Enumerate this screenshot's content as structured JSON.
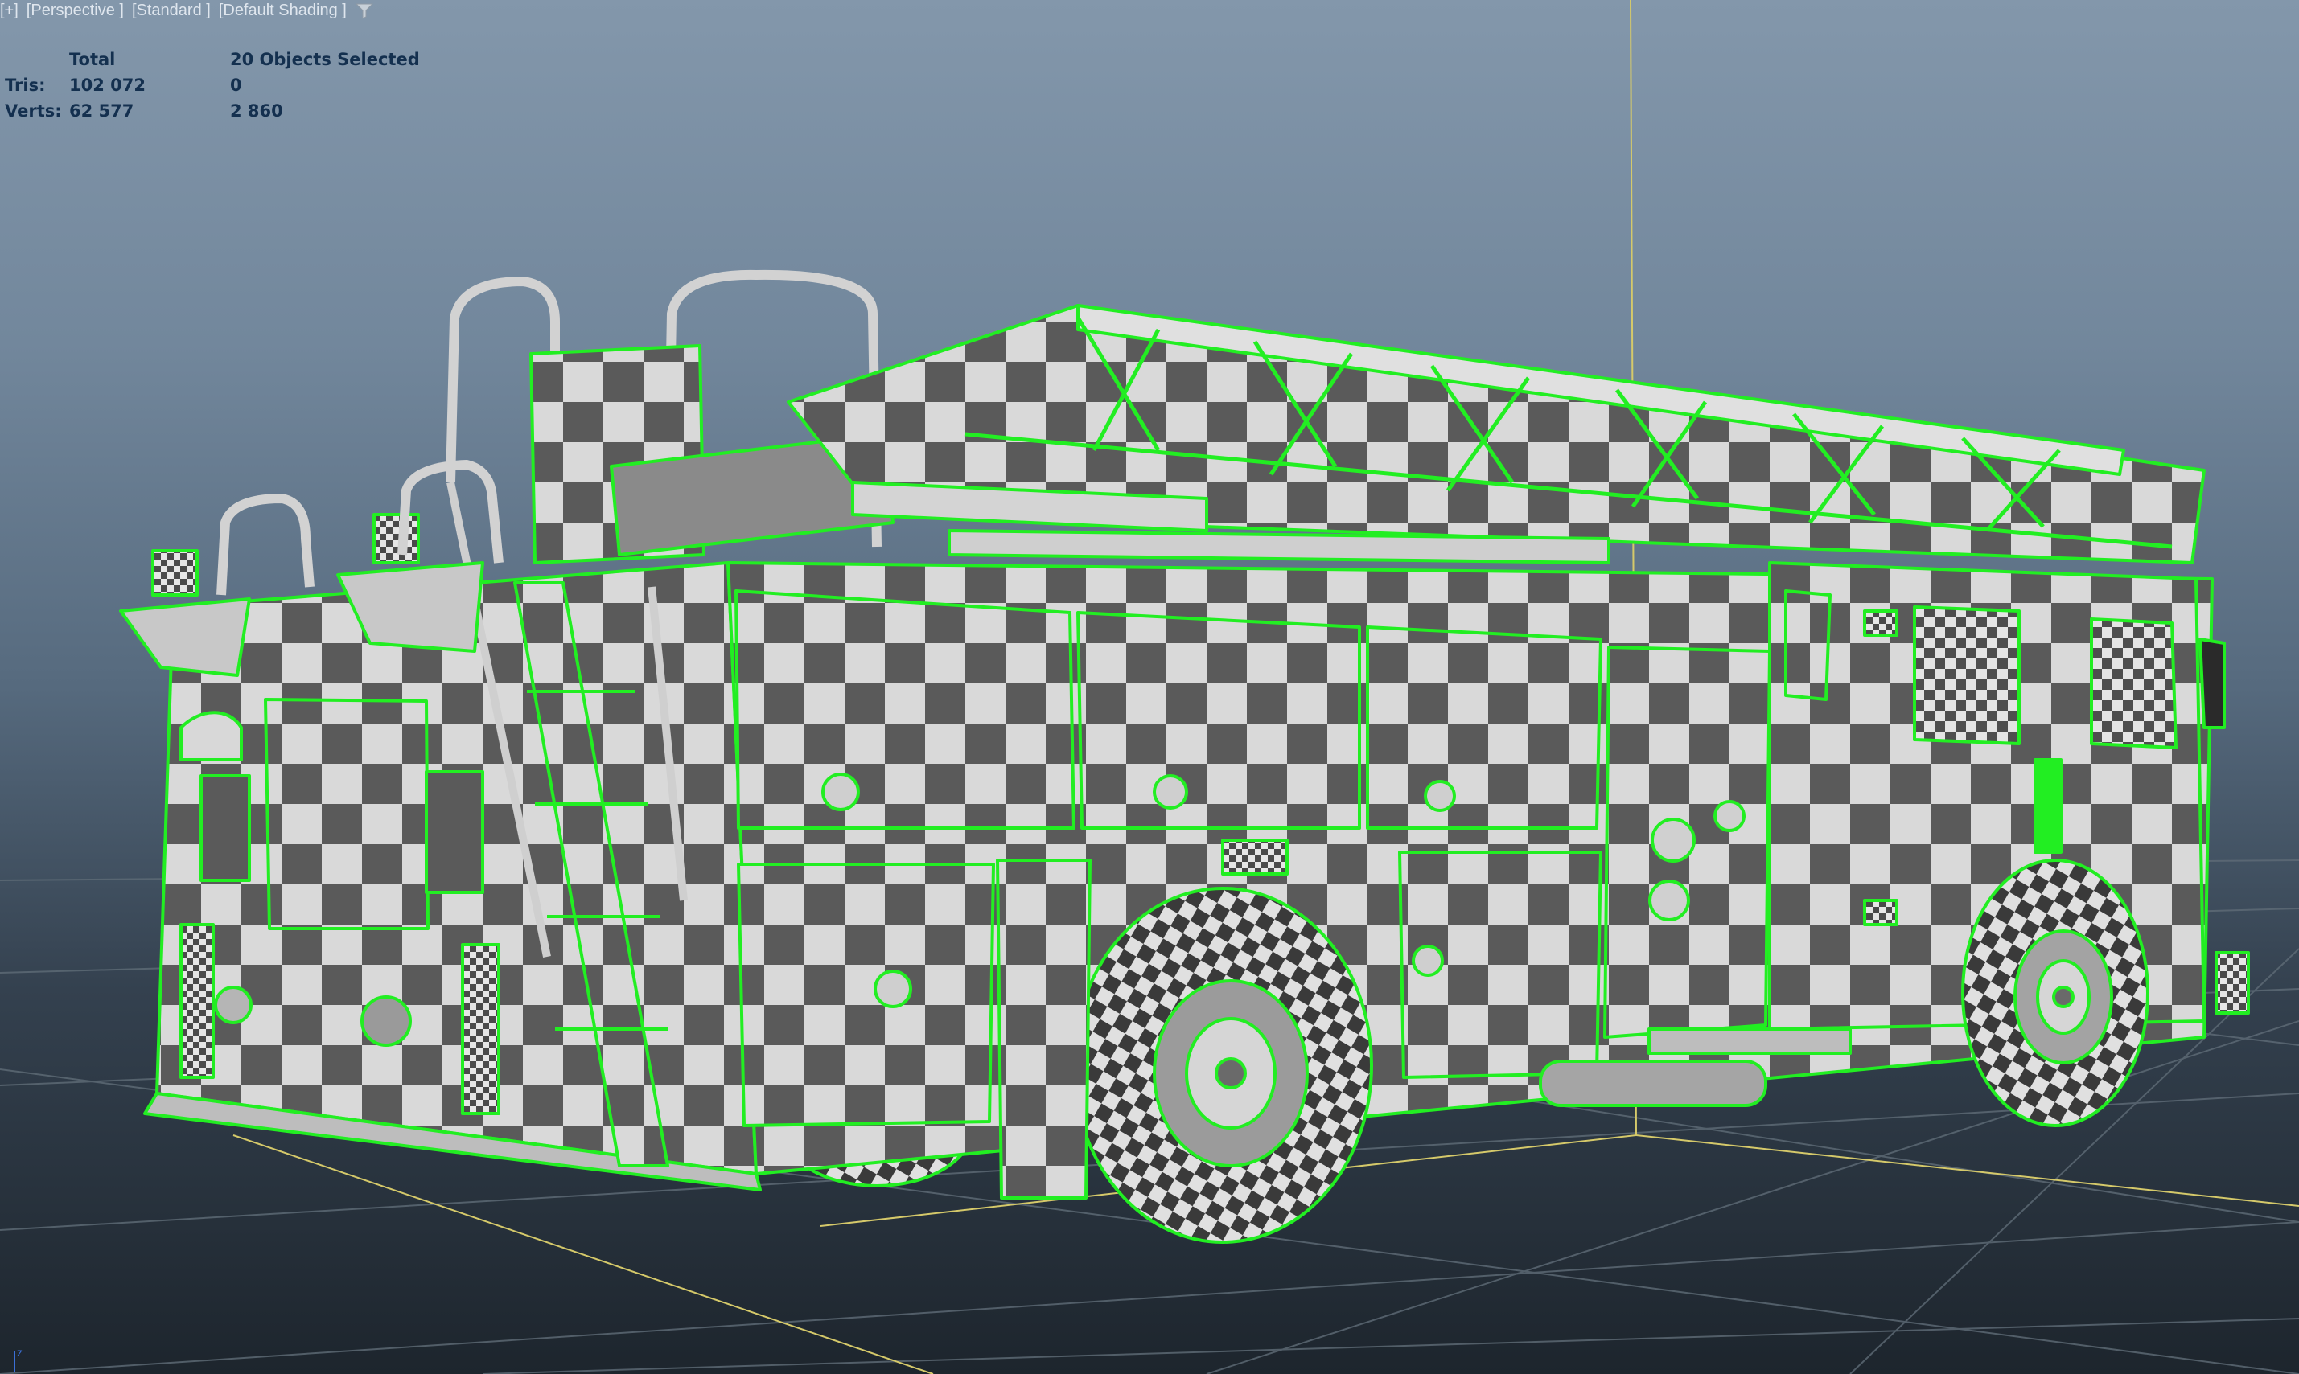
{
  "viewport": {
    "menu": {
      "plus": "[+]",
      "view": "[Perspective ]",
      "mode": "[Standard ]",
      "shading": "[Default Shading ]"
    },
    "filter_icon": "filter-funnel-icon",
    "stats": {
      "header_total": "Total",
      "header_selected": "20 Objects Selected",
      "rows": [
        {
          "label": "Tris:",
          "total": "102 072",
          "selected": "0"
        },
        {
          "label": "Verts:",
          "total": "62 577",
          "selected": "2 860"
        }
      ]
    },
    "axis_label": "z"
  },
  "colors": {
    "selection_wireframe": "#22ee22",
    "checker_light": "#d9d9d9",
    "checker_dark": "#5a5a5a",
    "grid_line": "#5f6c77",
    "pivot_line": "#d5c96a",
    "stats_text": "#14304f",
    "menu_text": "#dfe6ee"
  }
}
